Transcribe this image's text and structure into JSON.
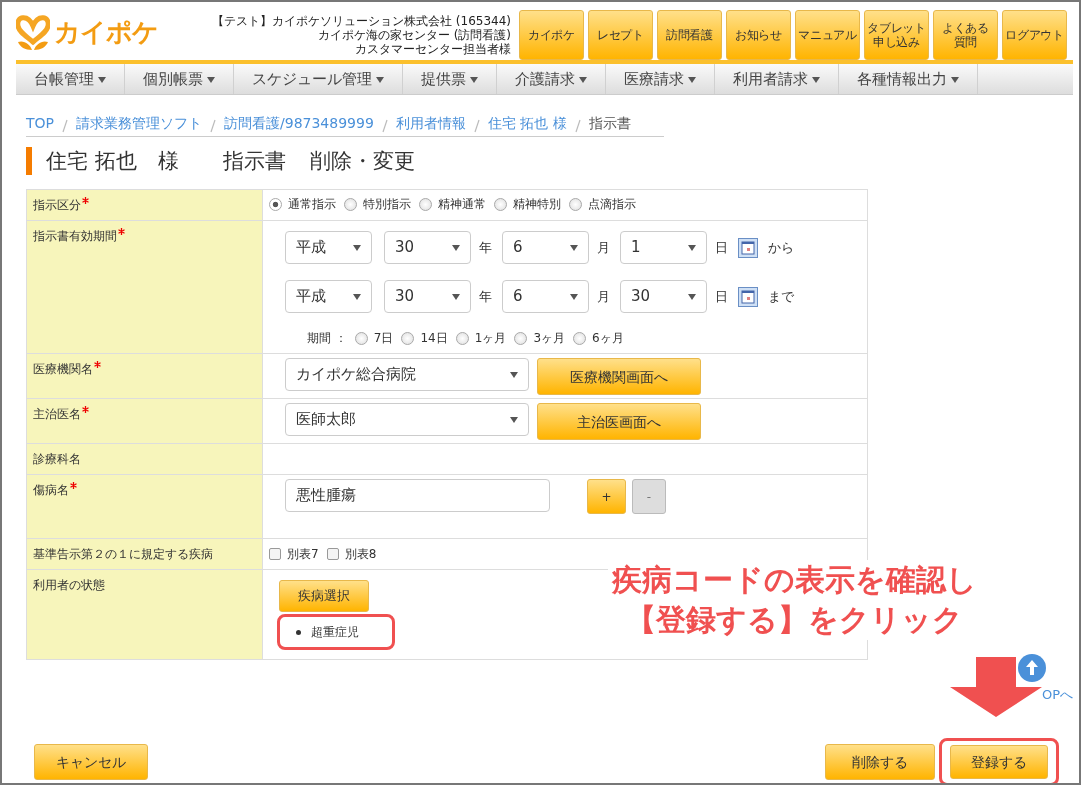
{
  "header": {
    "logo": "カイポケ",
    "account_lines": [
      "【テスト】カイポケソリューション株式会社 (165344)",
      "カイポケ海の家センター (訪問看護)",
      "カスタマーセンター担当者様"
    ],
    "buttons": [
      {
        "lines": [
          "カイポケ"
        ]
      },
      {
        "lines": [
          "レセプト"
        ]
      },
      {
        "lines": [
          "訪問看護"
        ]
      },
      {
        "lines": [
          "お知らせ"
        ]
      },
      {
        "lines": [
          "マニュアル"
        ]
      },
      {
        "lines": [
          "タブレット",
          "申し込み"
        ]
      },
      {
        "lines": [
          "よくある",
          "質問"
        ]
      },
      {
        "lines": [
          "ログアウト"
        ]
      }
    ]
  },
  "menu": [
    "台帳管理",
    "個別帳票",
    "スケジュール管理",
    "提供票",
    "介護請求",
    "医療請求",
    "利用者請求",
    "各種情報出力"
  ],
  "breadcrumb": [
    {
      "label": "TOP",
      "kind": "link"
    },
    {
      "label": "請求業務管理ソフト",
      "kind": "link"
    },
    {
      "label": "訪問看護/9873489999",
      "kind": "link"
    },
    {
      "label": "利用者情報",
      "kind": "link"
    },
    {
      "label": "住宅 拓也 様",
      "kind": "link"
    },
    {
      "label": "指示書",
      "kind": "current"
    }
  ],
  "title": {
    "name": "住宅 拓也　様",
    "document": "指示書",
    "action": "削除・変更"
  },
  "form": [
    {
      "kind": "radios",
      "label": "指示区分",
      "required": true,
      "options": [
        {
          "label": "通常指示",
          "selected": true
        },
        {
          "label": "特別指示",
          "selected": false
        },
        {
          "label": "精神通常",
          "selected": false
        },
        {
          "label": "精神特別",
          "selected": false
        },
        {
          "label": "点滴指示",
          "selected": false
        }
      ]
    },
    {
      "kind": "period",
      "label": "指示書有効期間",
      "required": true,
      "dates": [
        {
          "era": "平成",
          "year": "30",
          "year_unit": "年",
          "month": "6",
          "month_unit": "月",
          "day": "1",
          "day_unit": "日",
          "suffix": "から"
        },
        {
          "era": "平成",
          "year": "30",
          "year_unit": "年",
          "month": "6",
          "month_unit": "月",
          "day": "30",
          "day_unit": "日",
          "suffix": "まで"
        }
      ],
      "span_label": "期間 ：",
      "spans": [
        {
          "label": "7日",
          "selected": false
        },
        {
          "label": "14日",
          "selected": false
        },
        {
          "label": "1ヶ月",
          "selected": false
        },
        {
          "label": "3ヶ月",
          "selected": false
        },
        {
          "label": "6ヶ月",
          "selected": false
        }
      ]
    },
    {
      "kind": "select_button",
      "label": "医療機関名",
      "required": true,
      "value": "カイポケ総合病院",
      "button": "医療機関画面へ"
    },
    {
      "kind": "select_button",
      "label": "主治医名",
      "required": true,
      "value": "医師太郎",
      "button": "主治医画面へ"
    },
    {
      "kind": "empty",
      "label": "診療科名",
      "required": false
    },
    {
      "kind": "input_buttons",
      "label": "傷病名",
      "required": true,
      "value": "悪性腫瘍",
      "buttons": [
        {
          "label": "+",
          "disabled": false
        },
        {
          "label": "-",
          "disabled": true
        }
      ]
    },
    {
      "kind": "checkboxes",
      "label": "基準告示第２の１に規定する疾病",
      "required": false,
      "options": [
        {
          "label": "別表7",
          "checked": false
        },
        {
          "label": "別表8",
          "checked": false
        }
      ]
    },
    {
      "kind": "condition",
      "label": "利用者の状態",
      "required": false,
      "button": "疾病選択",
      "items": [
        "超重症児"
      ]
    }
  ],
  "annotation": {
    "lines": [
      "疾病コードの表示を確認し",
      "【登録する】をクリック"
    ]
  },
  "page_top": "OPへ",
  "footer": {
    "cancel": "キャンセル",
    "delete": "削除する",
    "register": "登録する"
  }
}
